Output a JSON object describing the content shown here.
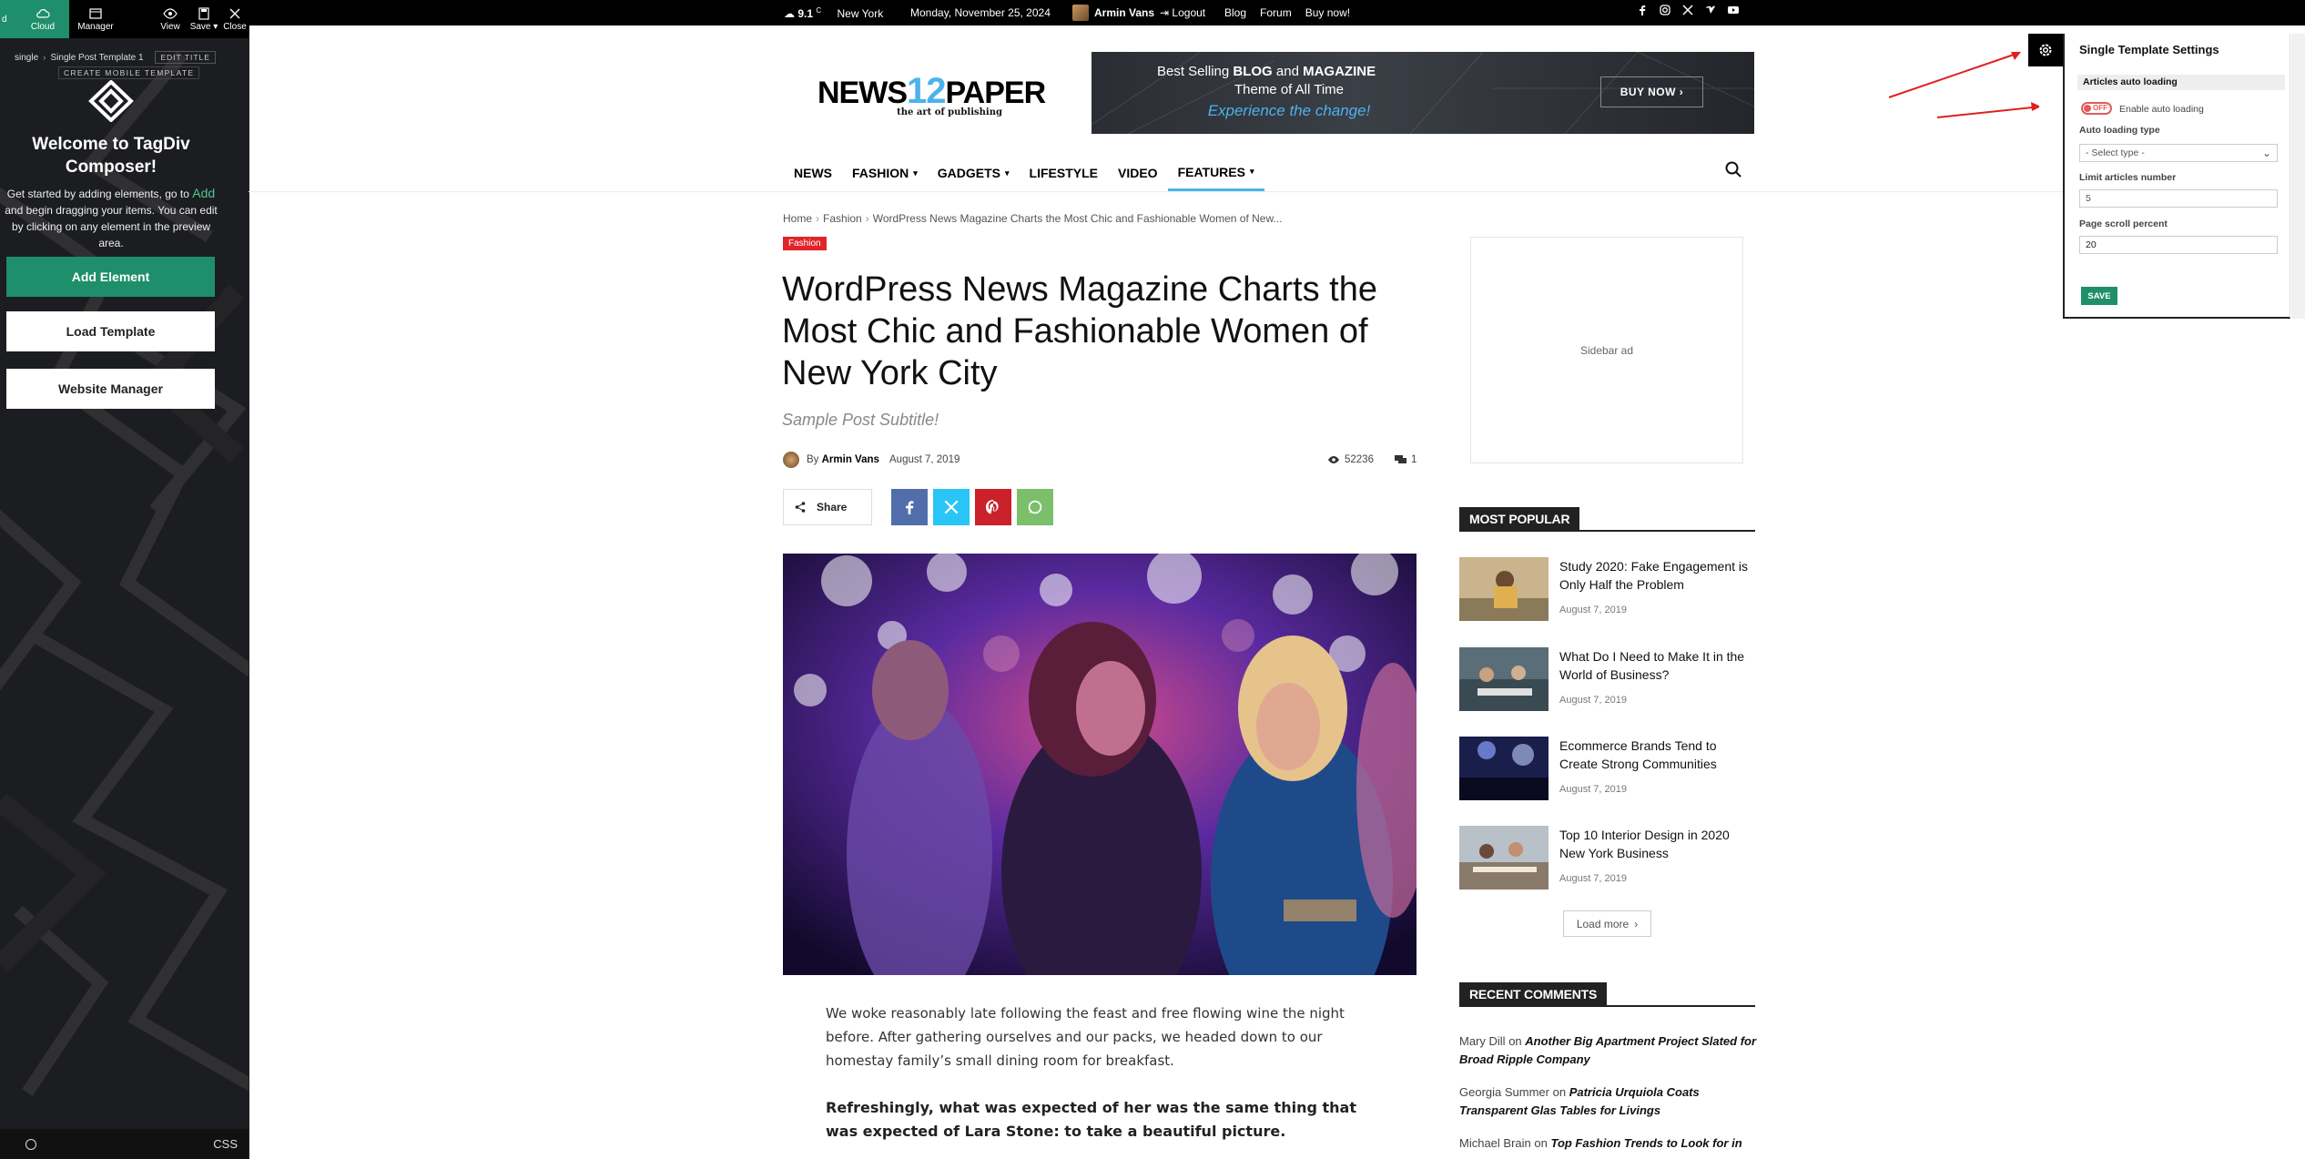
{
  "composer": {
    "toolbar": {
      "first": "d",
      "cloud": "Cloud",
      "manager": "Manager",
      "view": "View",
      "save": "Save",
      "close": "Close"
    },
    "breadcrumb": {
      "root": "single",
      "template": "Single Post Template 1",
      "edit_title": "EDIT TITLE"
    },
    "mobile_template": "CREATE MOBILE TEMPLATE",
    "welcome": "Welcome to TagDiv Composer!",
    "desc_pre": "Get started by adding elements, go to ",
    "desc_add": "Add",
    "desc_post": " and begin dragging your items. You can edit by clicking on any element in the preview area.",
    "add_element": "Add Element",
    "load_template": "Load Template",
    "website_manager": "Website Manager",
    "css": "CSS"
  },
  "topbar": {
    "temp": "9.1",
    "unit": "C",
    "city": "New York",
    "date": "Monday, November 25, 2024",
    "user": "Armin Vans",
    "links": [
      "Logout",
      "Blog",
      "Forum",
      "Buy now!"
    ],
    "social_icons": [
      "facebook-icon",
      "instagram-icon",
      "x-icon",
      "vimeo-icon",
      "youtube-icon"
    ]
  },
  "logo": {
    "pre": "NEWS",
    "num": "12",
    "post": "PAPER",
    "tagline": "the art of publishing"
  },
  "banner": {
    "line1_pre": "Best Selling ",
    "line1_b1": "BLOG",
    "line1_mid": " and ",
    "line1_b2": "MAGAZINE",
    "line2": "Theme of All Time",
    "line3": "Experience the change!",
    "button": "BUY NOW"
  },
  "nav": [
    "NEWS",
    "FASHION",
    "GADGETS",
    "LIFESTYLE",
    "VIDEO",
    "FEATURES"
  ],
  "article": {
    "breadcrumb": [
      "Home",
      "Fashion",
      "WordPress News Magazine Charts the Most Chic and Fashionable Women of New..."
    ],
    "category": "Fashion",
    "title": "WordPress News Magazine Charts the Most Chic and Fashionable Women of New York City",
    "subtitle": "Sample Post Subtitle!",
    "by": "By",
    "author": "Armin Vans",
    "date": "August 7, 2019",
    "views": "52236",
    "comments": "1",
    "share": "Share",
    "p1": "We woke reasonably late following the feast and free flowing wine the night before. After gathering ourselves and our packs, we headed down to our homestay family’s small dining room for breakfast.",
    "p2": "Refreshingly, what was expected of her was the same thing that was expected of Lara Stone: to take a beautiful picture."
  },
  "sidebar": {
    "ad": "Sidebar ad",
    "popular_title": "MOST POPULAR",
    "popular": [
      {
        "title": "Study 2020: Fake Engagement is Only Half the Problem",
        "date": "August 7, 2019"
      },
      {
        "title": "What Do I Need to Make It in the World of Business?",
        "date": "August 7, 2019"
      },
      {
        "title": "Ecommerce Brands Tend to Create Strong Communities",
        "date": "August 7, 2019"
      },
      {
        "title": "Top 10 Interior Design in 2020 New York Business",
        "date": "August 7, 2019"
      }
    ],
    "load_more": "Load more",
    "comments_title": "RECENT COMMENTS",
    "comments": [
      {
        "author": "Mary Dill",
        "on": "on",
        "post": "Another Big Apartment Project Slated for Broad Ripple Company"
      },
      {
        "author": "Georgia Summer",
        "on": "on",
        "post": "Patricia Urquiola Coats Transparent Glas Tables for Livings"
      },
      {
        "author": "Michael Brain",
        "on": "on",
        "post": "Top Fashion Trends to Look for in"
      }
    ]
  },
  "settings": {
    "title": "Single Template Settings",
    "section": "Articles auto loading",
    "toggle": "OFF",
    "enable_label": "Enable auto loading",
    "type_label": "Auto loading type",
    "type_value": "- Select type -",
    "limit_label": "Limit articles number",
    "limit_value": "5",
    "scroll_label": "Page scroll percent",
    "scroll_value": "20",
    "save": "SAVE"
  },
  "colors": {
    "accent": "#4db2ec",
    "composer_green": "#1e8f6a",
    "fashion_red": "#e0242a",
    "arrow_red": "#e02020"
  }
}
